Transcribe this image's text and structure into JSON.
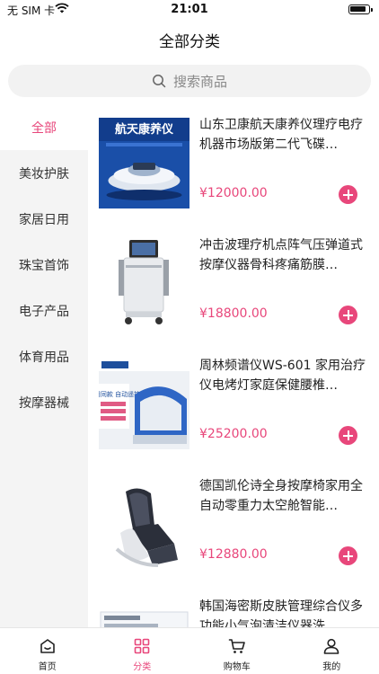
{
  "status_bar": {
    "carrier": "无 SIM 卡",
    "time": "21:01"
  },
  "header": {
    "title": "全部分类"
  },
  "search": {
    "placeholder": "搜索商品"
  },
  "sidebar": {
    "items": [
      {
        "label": "全部",
        "active": true
      },
      {
        "label": "美妆护肤"
      },
      {
        "label": "家居日用"
      },
      {
        "label": "珠宝首饰"
      },
      {
        "label": "电子产品"
      },
      {
        "label": "体育用品"
      },
      {
        "label": "按摩器械"
      }
    ]
  },
  "products": [
    {
      "name": "山东卫康航天康养仪理疗电疗机器市场版第二代飞碟…",
      "price": "¥12000.00",
      "image_text": "航天康养仪"
    },
    {
      "name": "冲击波理疗机点阵气压弹道式按摩仪器骨科疼痛筋膜…",
      "price": "¥18800.00"
    },
    {
      "name": "周林频谱仪WS-601 家用治疗仪电烤灯家庭保健腰椎…",
      "price": "¥25200.00",
      "image_text": "医用同款 自动遥控"
    },
    {
      "name": "德国凯伦诗全身按摩椅家用全自动零重力太空舱智能…",
      "price": "¥12880.00"
    },
    {
      "name": "韩国海密斯皮肤管理综合仪多功能小气泡清洁仪器洗…",
      "price": ""
    }
  ],
  "tab_bar": {
    "tabs": [
      {
        "label": "首页",
        "icon": "home-icon"
      },
      {
        "label": "分类",
        "icon": "grid-icon",
        "active": true
      },
      {
        "label": "购物车",
        "icon": "cart-icon"
      },
      {
        "label": "我的",
        "icon": "user-icon"
      }
    ]
  },
  "colors": {
    "accent": "#e8477b",
    "sidebar_bg": "#f4f4f4",
    "search_bg": "#f2f2f2"
  }
}
